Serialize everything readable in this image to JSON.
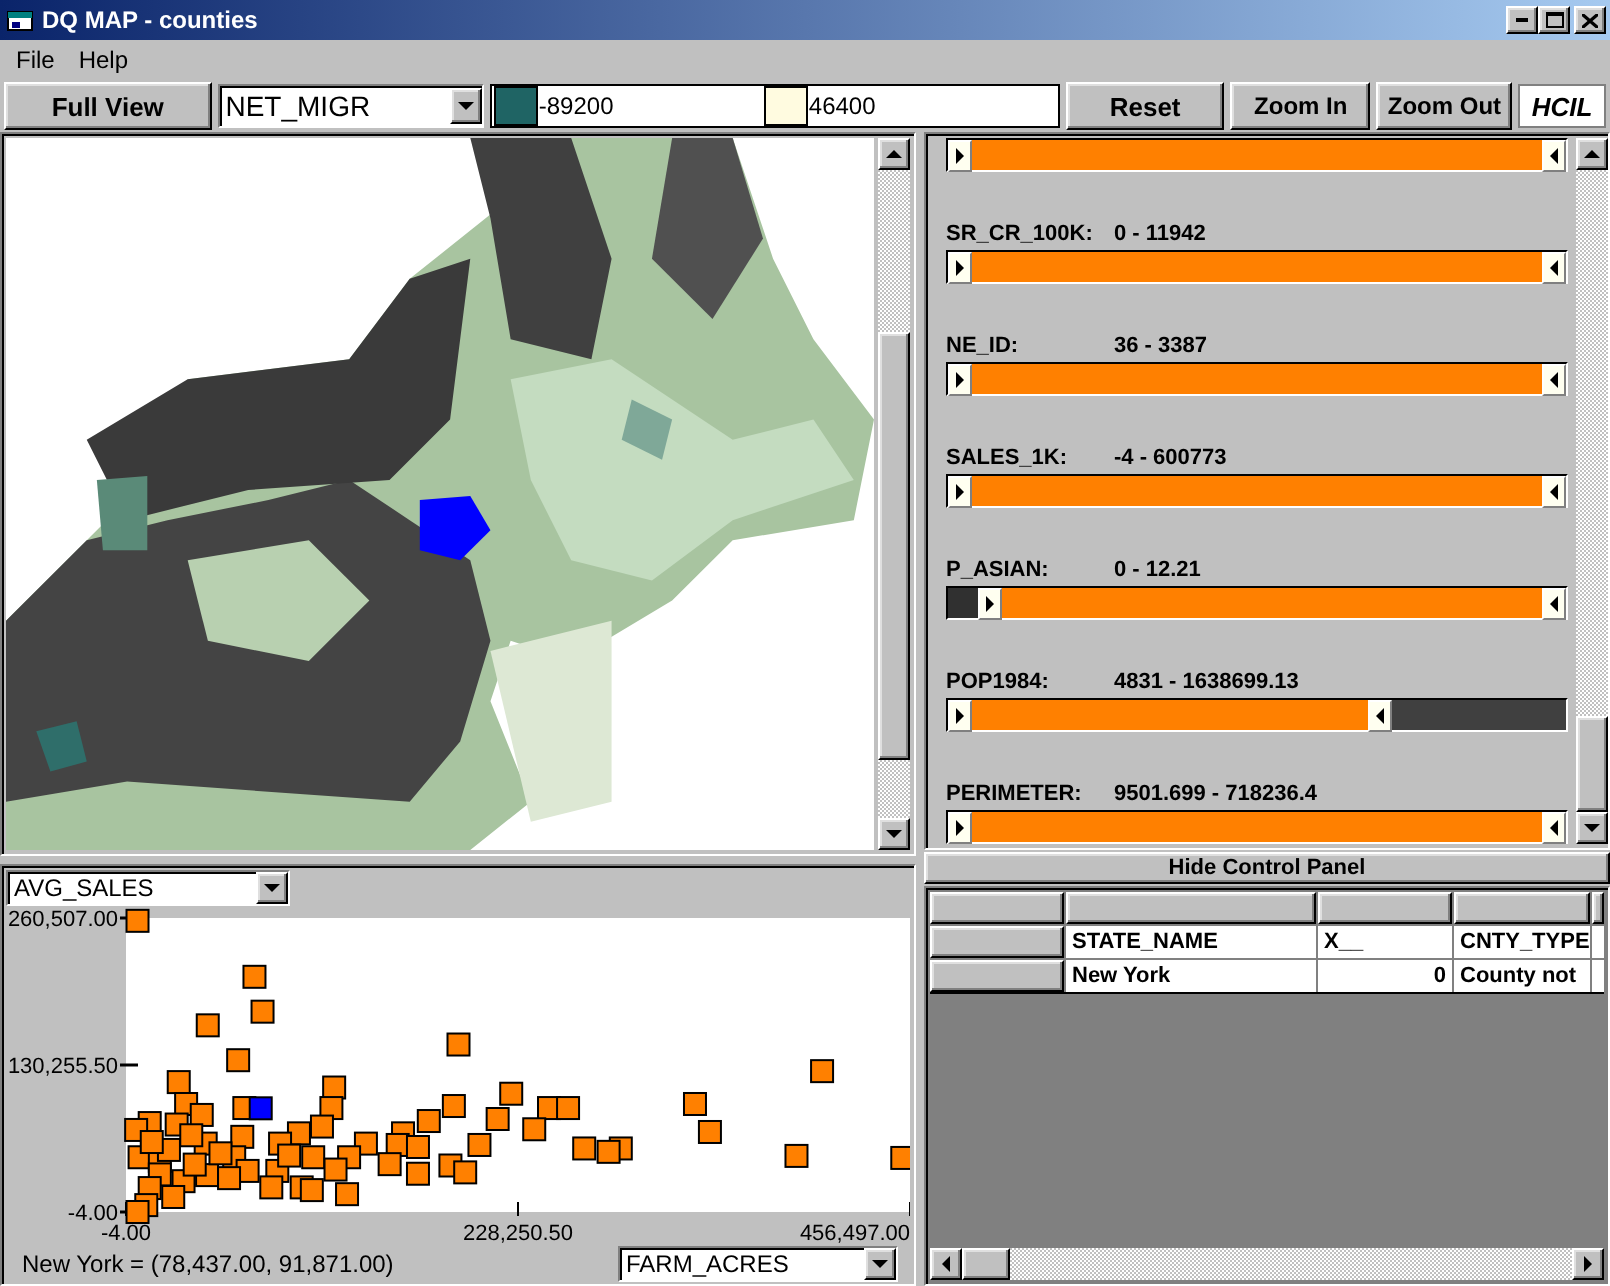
{
  "window": {
    "title": "DQ MAP - counties"
  },
  "menu": [
    "File",
    "Help"
  ],
  "toolbar": {
    "full_view": "Full View",
    "attribute": "NET_MIGR",
    "legend": [
      {
        "color": "#1f6464",
        "label": "-89200"
      },
      {
        "color": "#fffbe0",
        "label": "46400"
      }
    ],
    "buttons": [
      "Reset",
      "Zoom In",
      "Zoom Out"
    ],
    "logo": "HCIL"
  },
  "sliders": [
    {
      "low_handle": {
        "level": 0
      },
      "high_handle": {
        "level": 1
      }
    },
    {
      "label": "SR_CR_100K:",
      "range": "0 - 11942",
      "low_handle": {
        "level": 0
      },
      "high_handle": {
        "level": 1
      }
    },
    {
      "label": "NE_ID:",
      "range": "36 - 3387",
      "low_handle": {
        "level": 0
      },
      "high_handle": {
        "level": 1
      }
    },
    {
      "label": "SALES_1K:",
      "range": "-4 - 600773",
      "low_handle": {
        "level": 0
      },
      "high_handle": {
        "level": 1
      }
    },
    {
      "label": "P_ASIAN:",
      "range": "0 - 12.21",
      "low_handle": {
        "level": 0.05
      },
      "high_handle": {
        "level": 1
      }
    },
    {
      "label": "POP1984:",
      "range": "4831 - 1638699.13",
      "low_handle": {
        "level": 0
      },
      "high_handle": {
        "level": 0.72
      }
    },
    {
      "label": "PERIMETER:",
      "range": "9501.699 - 718236.4",
      "low_handle": {
        "level": 0
      },
      "high_handle": {
        "level": 1
      }
    }
  ],
  "hide_button": "Hide Control Panel",
  "scatter": {
    "y_attribute": "AVG_SALES",
    "x_attribute": "FARM_ACRES",
    "status": "New York = (78,437.00, 91,871.00)",
    "chart_data": {
      "type": "scatter",
      "xlim": [
        -4,
        456497
      ],
      "ylim": [
        -4,
        260507
      ],
      "xticks": [
        {
          "value": -4,
          "label": "-4.00"
        },
        {
          "value": 228250.5,
          "label": "228,250.50"
        },
        {
          "value": 456497,
          "label": "456,497.00"
        }
      ],
      "yticks": [
        {
          "value": -4,
          "label": "-4.00"
        },
        {
          "value": 130255.5,
          "label": "130,255.50"
        },
        {
          "value": 260507,
          "label": "260,507.00"
        }
      ],
      "series": [
        {
          "color": "#ff8000",
          "x": [
            6700,
            74800,
            79500,
            47600,
            193600,
            65300,
            405300,
            30700,
            121200,
            224300,
            35000,
            190900,
            68900,
            331300,
            246300,
            257400,
            44100,
            119600,
            176300,
            216400,
            13800,
            29500,
            5900,
            340000,
            237700,
            114100,
            161300,
            205800,
            266800,
            288100,
            281000,
            158200,
            170000,
            139700,
            46400,
            67700,
            100700,
            390400,
            452000,
            129900,
            109000,
            89700,
            7900,
            19700,
            63000,
            153500,
            188900,
            170000,
            197500,
            122000,
            88100,
            47200,
            70800,
            19700,
            33500,
            13800,
            84600,
            102300,
            108200,
            128700,
            27500,
            11800,
            6700,
            25000,
            40000,
            55000,
            15000,
            95000,
            60000,
            38000
          ],
          "values": [
            258000,
            208400,
            177500,
            165400,
            148400,
            134500,
            124800,
            115100,
            110300,
            104800,
            95700,
            93900,
            92100,
            95700,
            92100,
            92100,
            86000,
            92100,
            80600,
            82400,
            78800,
            77500,
            72700,
            70900,
            73300,
            75700,
            69700,
            59400,
            56300,
            56300,
            53300,
            59400,
            57600,
            60600,
            60600,
            66600,
            69700,
            49700,
            47900,
            48500,
            48500,
            60600,
            48500,
            45400,
            48500,
            42400,
            41200,
            33900,
            35100,
            37600,
            36400,
            32700,
            36400,
            33300,
            27300,
            21200,
            21800,
            21800,
            19400,
            15800,
            13300,
            6100,
            0,
            55000,
            42000,
            52000,
            62000,
            50000,
            30000,
            68000
          ]
        },
        {
          "color": "#0000ff",
          "x": [
            78437
          ],
          "values": [
            91871
          ]
        }
      ]
    }
  },
  "table": {
    "columns": [
      {
        "label": "STATE_NAME",
        "kind": "text"
      },
      {
        "label": "X__",
        "kind": "number"
      },
      {
        "label": "CNTY_TYPE",
        "kind": "text"
      }
    ],
    "rows": [
      [
        "New York",
        "0",
        "County not"
      ]
    ]
  }
}
